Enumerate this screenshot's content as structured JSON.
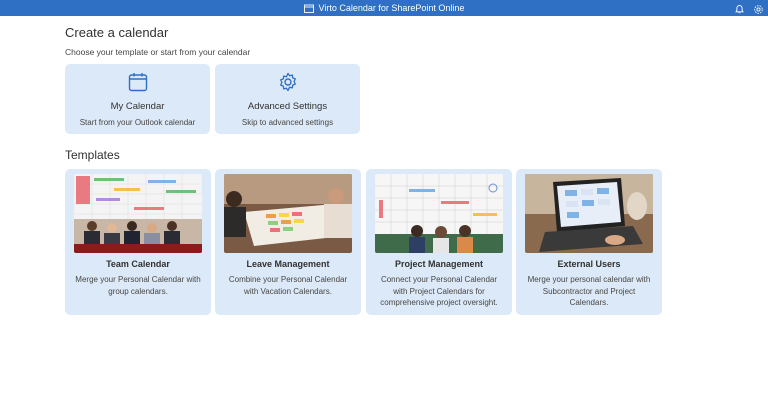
{
  "header": {
    "title": "Virto Calendar for SharePoint Online"
  },
  "page": {
    "heading": "Create a calendar",
    "subheading": "Choose your template or start from your calendar",
    "templates_heading": "Templates"
  },
  "options": [
    {
      "title": "My Calendar",
      "desc": "Start from your Outlook calendar",
      "icon": "calendar-icon"
    },
    {
      "title": "Advanced Settings",
      "desc": "Skip to advanced settings",
      "icon": "gear-icon"
    }
  ],
  "templates": [
    {
      "title": "Team Calendar",
      "desc": "Merge your Personal Calendar with group calendars."
    },
    {
      "title": "Leave Management",
      "desc": "Combine your Personal Calendar with Vacation Calendars."
    },
    {
      "title": "Project Management",
      "desc": "Connect your Personal Calendar with Project Calendars for comprehensive project oversight."
    },
    {
      "title": "External Users",
      "desc": "Merge your personal calendar with Subcontractor and Project Calendars."
    }
  ],
  "colors": {
    "brand": "#2f6fc4",
    "card": "#dce9f8"
  }
}
